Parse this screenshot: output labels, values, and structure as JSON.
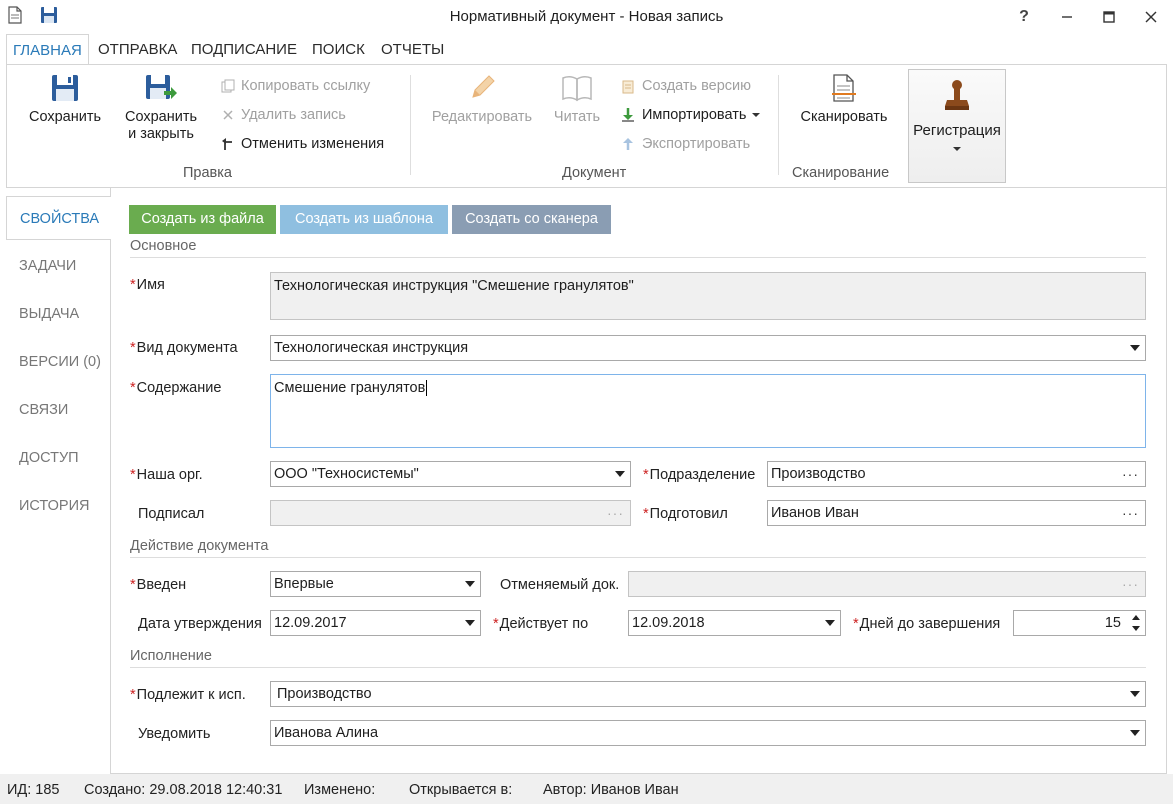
{
  "window": {
    "title": "Нормативный документ - Новая запись",
    "help": "?"
  },
  "ribbon_tabs": [
    "ГЛАВНАЯ",
    "ОТПРАВКА",
    "ПОДПИСАНИЕ",
    "ПОИСК",
    "ОТЧЕТЫ"
  ],
  "ribbon": {
    "edit_group": {
      "label": "Правка",
      "save": "Сохранить",
      "save_close_1": "Сохранить",
      "save_close_2": "и закрыть",
      "copy_link": "Копировать ссылку",
      "delete_record": "Удалить запись",
      "undo_changes": "Отменить изменения"
    },
    "document_group": {
      "label": "Документ",
      "edit": "Редактировать",
      "read": "Читать",
      "create_version": "Создать версию",
      "import": "Импортировать",
      "export": "Экспортировать"
    },
    "scan_group": {
      "label": "Сканирование",
      "scan": "Сканировать"
    },
    "registration": "Регистрация"
  },
  "side_tabs": [
    "СВОЙСТВА",
    "ЗАДАЧИ",
    "ВЫДАЧА",
    "ВЕРСИИ (0)",
    "СВЯЗИ",
    "ДОСТУП",
    "ИСТОРИЯ"
  ],
  "create_buttons": {
    "from_file": "Создать из файла",
    "from_template": "Создать из шаблона",
    "from_scanner": "Создать со сканера"
  },
  "colors": {
    "from_file": "#6aac4f",
    "from_template": "#8fbfe0",
    "from_scanner": "#8a9db3",
    "accent": "#2a7ab8",
    "required": "#cc2222"
  },
  "sections": {
    "basic": "Основное",
    "action": "Действие документа",
    "execution": "Исполнение"
  },
  "form": {
    "required_mark": "*",
    "name_label": "Имя",
    "name_value": "Технологическая инструкция \"Смешение гранулятов\"",
    "doctype_label": "Вид документа",
    "doctype_value": "Технологическая инструкция",
    "content_label": "Содержание",
    "content_value": "Смешение гранулятов",
    "org_label": "Наша орг.",
    "org_value": "ООО \"Техносистемы\"",
    "dept_label": "Подразделение",
    "dept_value": "Производство",
    "signed_label": "Подписал",
    "signed_value": "",
    "prepared_label": "Подготовил",
    "prepared_value": "Иванов Иван",
    "introduced_label": "Введен",
    "introduced_value": "Впервые",
    "cancelled_label": "Отменяемый док.",
    "cancelled_value": "",
    "approval_date_label": "Дата утверждения",
    "approval_date_value": "12.09.2017",
    "valid_until_label": "Действует по",
    "valid_until_value": "12.09.2018",
    "days_left_label": "Дней до завершения",
    "days_left_value": "15",
    "executor_label": "Подлежит к исп.",
    "executor_value": "Производство",
    "notify_label": "Уведомить",
    "notify_value": "Иванова Алина",
    "ellipsis": "···"
  },
  "status": {
    "id": "ИД: 185",
    "created": "Создано: 29.08.2018 12:40:31",
    "modified": "Изменено:",
    "opened_in": "Открывается в:",
    "author": "Автор: Иванов Иван"
  }
}
